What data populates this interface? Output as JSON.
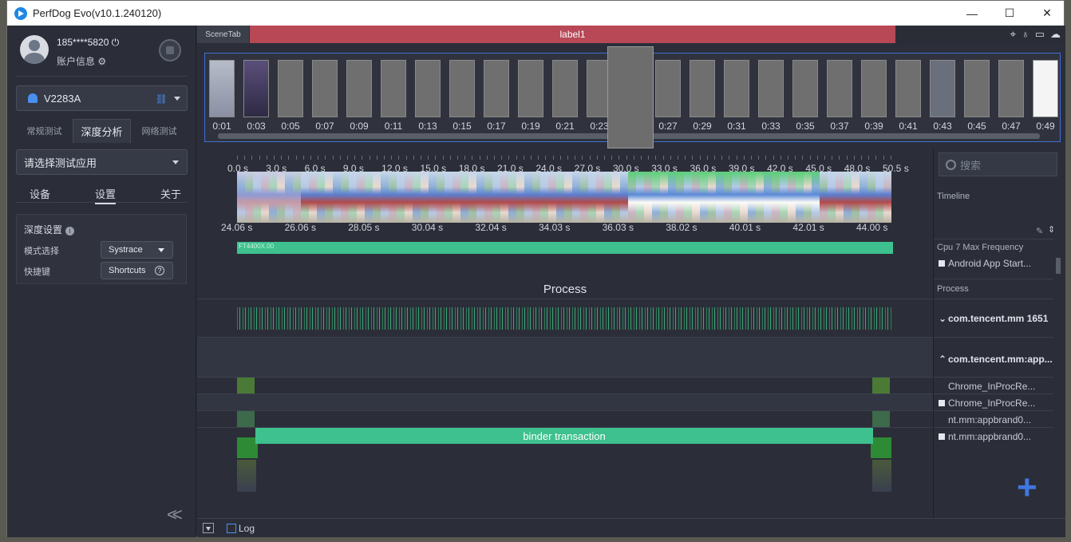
{
  "window": {
    "title": "PerfDog Evo(v10.1.240120)",
    "minimize": "—",
    "maximize": "☐",
    "close": "✕"
  },
  "user": {
    "name": "185****5820",
    "info_label": "账户信息"
  },
  "device": {
    "name": "V2283A"
  },
  "tabs": [
    "常规测试",
    "深度分析",
    "网络测试"
  ],
  "app_select": {
    "placeholder": "请选择测试应用"
  },
  "subtabs": [
    "设备",
    "设置",
    "关于"
  ],
  "settings": {
    "heading": "深度设置",
    "mode_label": "模式选择",
    "mode_value": "Systrace",
    "shortcut_label": "快捷键",
    "shortcut_value": "Shortcuts"
  },
  "scene": {
    "tab": "SceneTab",
    "label": "label1"
  },
  "thumbnails": [
    "0:01",
    "0:03",
    "0:05",
    "0:07",
    "0:09",
    "0:11",
    "0:13",
    "0:15",
    "0:17",
    "0:19",
    "0:21",
    "0:23",
    "0:27",
    "0:29",
    "0:31",
    "0:33",
    "0:35",
    "0:37",
    "0:39",
    "0:41",
    "0:43",
    "0:45",
    "0:47",
    "0:49"
  ],
  "ruler_ticks": [
    "0.0 s",
    "3.0 s",
    "6.0 s",
    "9.0 s",
    "12.0 s",
    "15.0 s",
    "18.0 s",
    "21.0 s",
    "24.0 s",
    "27.0 s",
    "30.0 s",
    "33.0 s",
    "36.0 s",
    "39.0 s",
    "42.0 s",
    "45.0 s",
    "48.0 s",
    "50.5 s"
  ],
  "zoom_ticks": [
    "24.06 s",
    "26.06 s",
    "28.05 s",
    "30.04 s",
    "32.04 s",
    "34.03 s",
    "36.03 s",
    "38.02 s",
    "40.01 s",
    "42.01 s",
    "44.00 s"
  ],
  "green_bar_label": "FT4400X.00",
  "process_title": "Process",
  "binder_label": "binder transaction",
  "log_label": "Log",
  "right_panel": {
    "search_placeholder": "搜索",
    "timeline_label": "Timeline",
    "cpu_label": "Cpu 7 Max Frequency",
    "android_app_start": "Android App Start...",
    "process_label": "Process",
    "proc1": "com.tencent.mm 1651",
    "proc2": "com.tencent.mm:app...",
    "thread1": "Chrome_InProcRe...",
    "thread2": "Chrome_InProcRe...",
    "thread3": "nt.mm:appbrand0...",
    "thread4": "nt.mm:appbrand0..."
  },
  "colors": {
    "scene_label_bg": "#b84856",
    "accent_green": "#3ec18e",
    "accent_blue": "#3f76e0"
  }
}
